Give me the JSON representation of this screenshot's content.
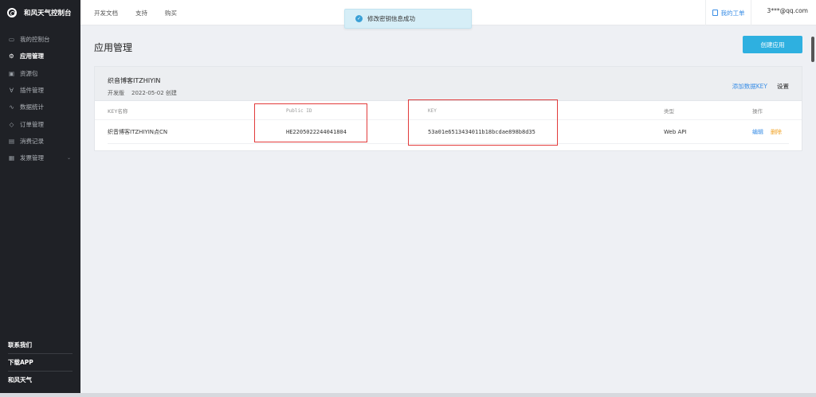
{
  "sidebar": {
    "brand": "和风天气控制台",
    "items": [
      {
        "label": "我的控制台",
        "icon": "monitor-icon",
        "glyph": "▭",
        "active": false
      },
      {
        "label": "应用管理",
        "icon": "gear-icon",
        "glyph": "⚙",
        "active": true
      },
      {
        "label": "资源包",
        "icon": "package-icon",
        "glyph": "▣",
        "active": false
      },
      {
        "label": "插件管理",
        "icon": "plugin-icon",
        "glyph": "∀",
        "active": false
      },
      {
        "label": "数据统计",
        "icon": "stats-icon",
        "glyph": "∿",
        "active": false
      },
      {
        "label": "订单管理",
        "icon": "tag-icon",
        "glyph": "◇",
        "active": false
      },
      {
        "label": "消费记录",
        "icon": "receipt-icon",
        "glyph": "▤",
        "active": false
      },
      {
        "label": "发票管理",
        "icon": "invoice-icon",
        "glyph": "▦",
        "active": false
      }
    ],
    "bottom": [
      "联系我们",
      "下载APP",
      "和风天气"
    ]
  },
  "topbar": {
    "links": [
      "开发文档",
      "支持",
      "购买"
    ],
    "work_order": "我的工单",
    "user": "3***@qq.com"
  },
  "toast": {
    "message": "修改密钥信息成功"
  },
  "main": {
    "title": "应用管理",
    "create_button": "创建应用",
    "app": {
      "name": "织音博客ITZHIYIN",
      "edition": "开发版",
      "created": "2022-05-02 创建",
      "add_key": "添加数据KEY",
      "settings": "设置"
    },
    "table": {
      "headers": [
        "KEY名称",
        "Public ID",
        "KEY",
        "类型",
        "操作"
      ],
      "rows": [
        {
          "name": "织音博客ITZHIYIN点CN",
          "public_id": "HE2205022244041804",
          "key": "53a01e6513434011b18bcdae898b8d35",
          "type": "Web API",
          "edit": "编辑",
          "delete": "删除"
        }
      ]
    }
  },
  "colors": {
    "accent": "#2eb0e0",
    "link": "#3a8ee6",
    "delete": "#f0a020",
    "highlight": "#e23b3b",
    "sidebar": "#1f2126"
  }
}
